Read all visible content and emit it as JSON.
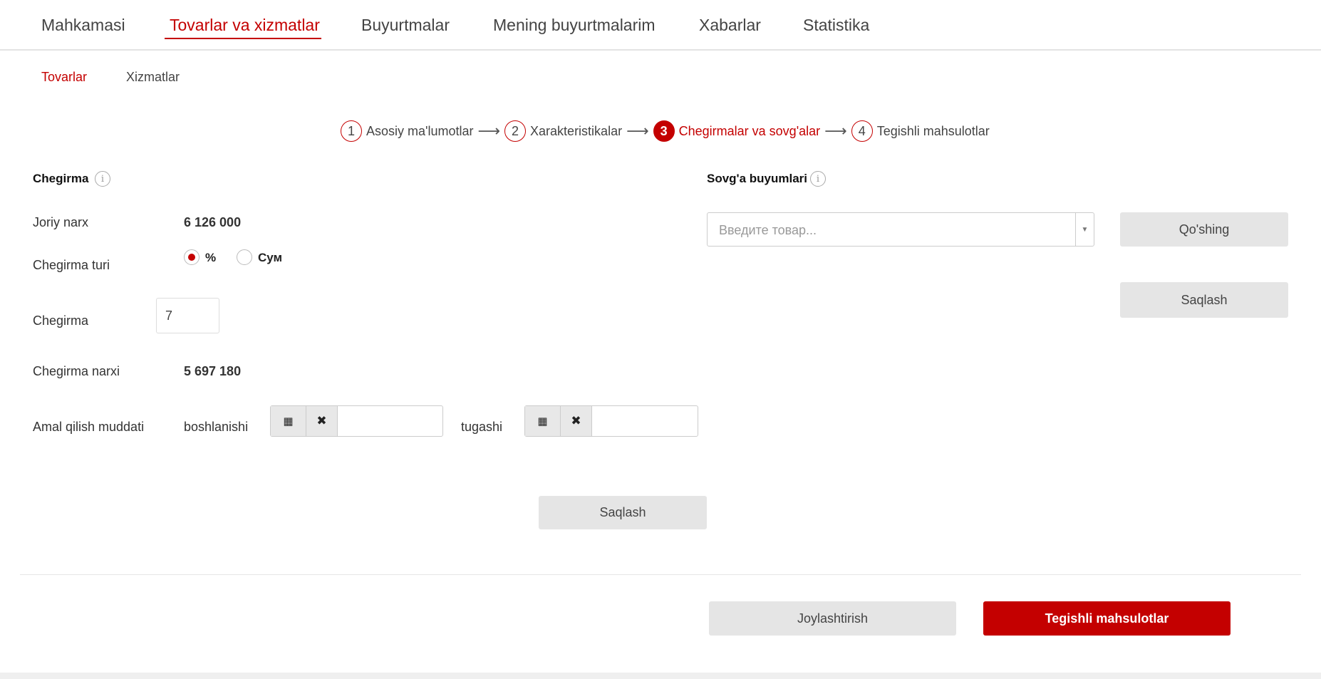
{
  "topnav": {
    "items": [
      "Mahkamasi",
      "Tovarlar va xizmatlar",
      "Buyurtmalar",
      "Mening buyurtmalarim",
      "Xabarlar",
      "Statistika"
    ]
  },
  "subnav": {
    "items": [
      "Tovarlar",
      "Xizmatlar"
    ]
  },
  "steps": [
    {
      "num": "1",
      "label": "Asosiy ma'lumotlar"
    },
    {
      "num": "2",
      "label": "Xarakteristikalar"
    },
    {
      "num": "3",
      "label": "Chegirmalar va sovg'alar"
    },
    {
      "num": "4",
      "label": "Tegishli mahsulotlar"
    }
  ],
  "discount": {
    "title": "Chegirma",
    "info": "i",
    "current_price_label": "Joriy narx",
    "current_price": "6 126 000",
    "type_label": "Chegirma turi",
    "type_options": [
      "%",
      "Сум"
    ],
    "amount_label": "Chegirma",
    "amount_value": "7",
    "discount_price_label": "Chegirma narxi",
    "discount_price": "5 697 180",
    "validity_label": "Amal qilish muddati",
    "start_label": "boshlanishi",
    "end_label": "tugashi",
    "save_label": "Saqlash"
  },
  "gifts": {
    "title": "Sovg'a buyumlari",
    "info": "i",
    "placeholder": "Введите товар...",
    "add_label": "Qo'shing",
    "save_label": "Saqlash"
  },
  "footer": {
    "publish_label": "Joylashtirish",
    "next_label": "Tegishli mahsulotlar"
  },
  "colors": {
    "accent": "#c40000",
    "button_gray": "#e5e5e5"
  }
}
